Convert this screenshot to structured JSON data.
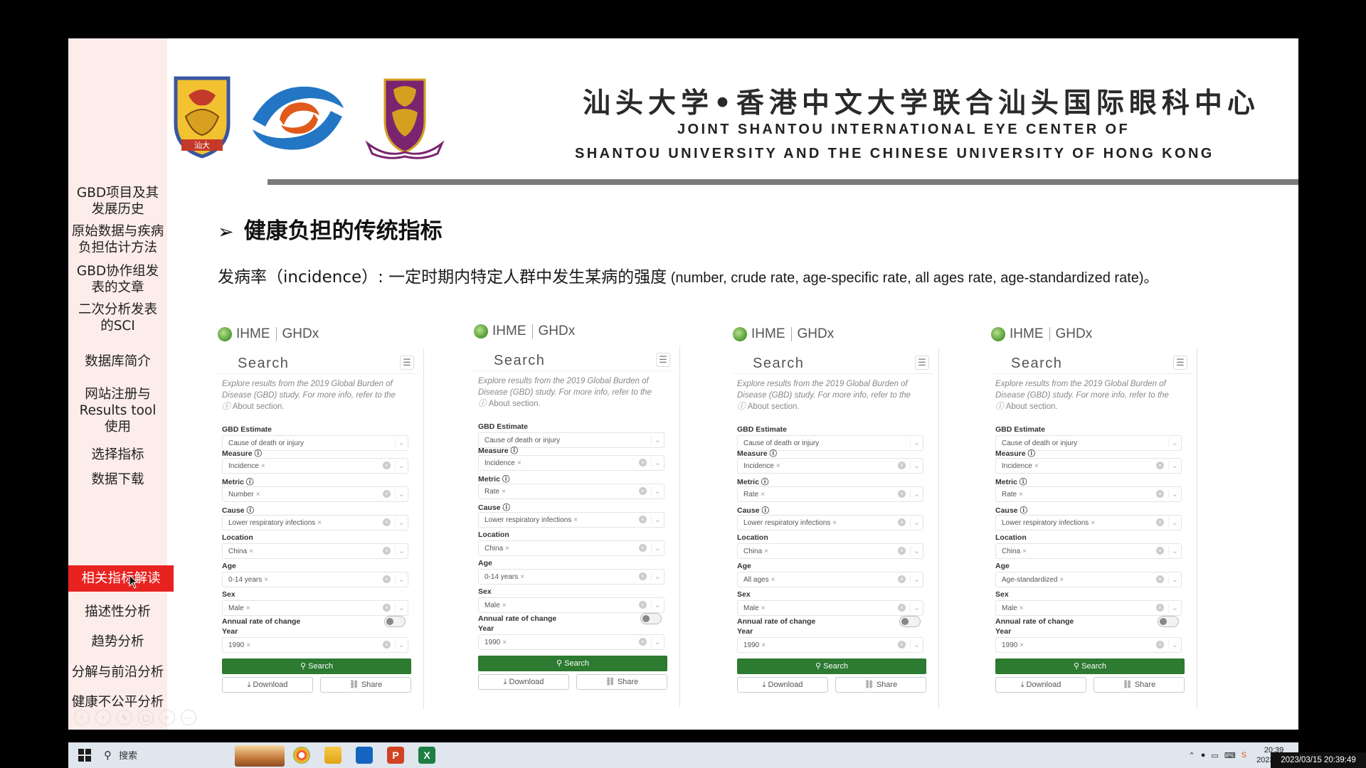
{
  "sidebar": {
    "items": [
      {
        "label": "GBD项目及其\n发展历史"
      },
      {
        "label": "原始数据与疾病\n负担估计方法"
      },
      {
        "label": "GBD协作组发\n表的文章"
      },
      {
        "label": "二次分析发表\n的SCI"
      },
      {
        "label": "数据库简介"
      },
      {
        "label": "网站注册与\nResults tool\n使用"
      },
      {
        "label": "选择指标"
      },
      {
        "label": "数据下载"
      },
      {
        "label": "相关指标解读"
      },
      {
        "label": "描述性分析"
      },
      {
        "label": "趋势分析"
      },
      {
        "label": "分解与前沿分析"
      },
      {
        "label": "健康不公平分析"
      }
    ],
    "active_index": 8
  },
  "header": {
    "title_cn": "汕头大学•香港中文大学联合汕头国际眼科中心",
    "title_en_line1": "JOINT SHANTOU INTERNATIONAL EYE CENTER  OF",
    "title_en_line2": "SHANTOU UNIVERSITY AND THE CHINESE UNIVERSITY OF HONG KONG",
    "logo_left_text": "汕大"
  },
  "content": {
    "section_title": "健康负担的传统指标",
    "definition_cn": "发病率（incidence）: 一定时期内特定人群中发生某病的强度",
    "definition_en": " (number, crude rate, age-specific rate, all ages rate, age-standardized rate)。"
  },
  "panel_common": {
    "brand_ihme": "IHME",
    "brand_ghdx": "GHDx",
    "search_title": "Search",
    "explore_text": "Explore results from the 2019 Global Burden of Disease (GBD) study. For more info, refer to the",
    "about_text": "About section.",
    "label_gbd": "GBD Estimate",
    "value_gbd": "Cause of death or injury",
    "label_measure": "Measure",
    "label_metric": "Metric",
    "label_cause": "Cause",
    "label_location": "Location",
    "label_age": "Age",
    "label_sex": "Sex",
    "label_annual": "Annual rate of change",
    "label_year": "Year",
    "search_button": "Search",
    "download_button": "Download",
    "share_button": "Share",
    "chip_remove": "×"
  },
  "panels": [
    {
      "measure": "Incidence",
      "metric": "Number",
      "cause": "Lower respiratory infections",
      "location": "China",
      "age": "0-14 years",
      "sex": "Male",
      "year": "1990"
    },
    {
      "measure": "Incidence",
      "metric": "Rate",
      "cause": "Lower respiratory infections",
      "location": "China",
      "age": "0-14 years",
      "sex": "Male",
      "year": "1990"
    },
    {
      "measure": "Incidence",
      "metric": "Rate",
      "cause": "Lower respiratory infections",
      "location": "China",
      "age": "All ages",
      "sex": "Male",
      "year": "1990"
    },
    {
      "measure": "Incidence",
      "metric": "Rate",
      "cause": "Lower respiratory infections",
      "location": "China",
      "age": "Age-standardized",
      "sex": "Male",
      "year": "1990"
    }
  ],
  "taskbar": {
    "search_label": "搜索",
    "time": "20:39",
    "date": "2023/3/15",
    "overlay_datetime": "2023/03/15 20:39:49"
  },
  "colors": {
    "active_nav": "#e8221f",
    "sidebar_bg": "#fcecea",
    "ghdx_green": "#2d7a31"
  }
}
